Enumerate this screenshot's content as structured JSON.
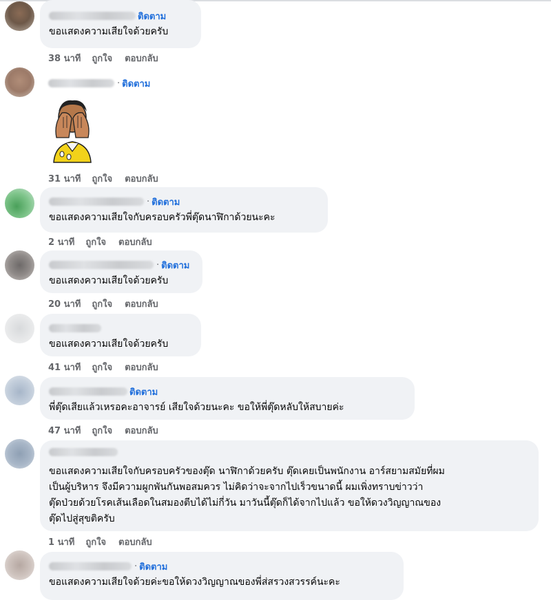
{
  "follow_label": "ติดตาม",
  "like_label": "ถูกใจ",
  "reply_label": "ตอบกลับ",
  "comments": [
    {
      "time": "38 นาที",
      "text": "ขอแสดงความเสียใจด้วยครับ"
    },
    {
      "time": "31 นาที",
      "text": "",
      "sticker": "crying-face-sticker"
    },
    {
      "time": "2 นาที",
      "text": "ขอแสดงความเสียใจกับครอบครัวพี่ตุ๊ดนาฬิกาด้วยนะคะ"
    },
    {
      "time": "20 นาที",
      "text": "ขอแสดงความเสียใจด้วยครับ"
    },
    {
      "time": "41 นาที",
      "text": "ขอแสดงความเสียใจด้วยครับ"
    },
    {
      "time": "47 นาที",
      "text": "พี่ตุ๊ดเสียแล้วเหรอคะอาจารย์ เสียใจด้วยนะคะ ขอให้พี่ตุ๊ดหลับให้สบายค่ะ"
    },
    {
      "time": "1 นาที",
      "lines": [
        "ขอแสดงความเสียใจกับครอบครัวของตุ๊ด นาฬิกาด้วยครับ ตุ๊ดเคยเป็นพนักงาน อาร์สยามสมัยที่ผม",
        "เป็นผู้บริหาร จึงมีความผูกพันกันพอสมควร ไม่คิดว่าจะจากไปเร็วขนาดนี้ ผมเพิ่งทราบข่าวว่า",
        "ตุ๊ดป่วยด้วยโรคเส้นเลือดในสมองตีบได้ไม่กี่วัน มาวันนี้ตุ๊ดก็ได้จากไปแล้ว ขอให้ดวงวิญญาณของ",
        "ตุ๊ดไปสู่สุขติครับ"
      ]
    },
    {
      "time": "",
      "text": "ขอแสดงความเสียใจด้วยค่ะขอให้ดวงวิญญาณของพี่ส่สรวงสวรรค์นะคะ"
    }
  ]
}
